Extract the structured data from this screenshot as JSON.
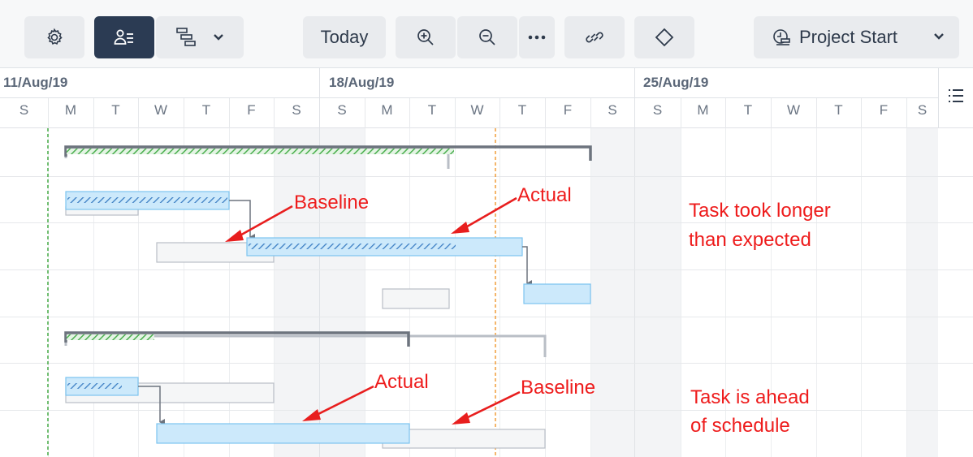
{
  "toolbar": {
    "settings_icon": "gear-icon",
    "resources_icon": "user-list-icon",
    "view_icon": "gantt-view-icon",
    "view_dropdown_icon": "chevron-down-icon",
    "today_label": "Today",
    "zoom_in_icon": "zoom-in-icon",
    "zoom_out_icon": "zoom-out-icon",
    "more_icon": "ellipsis-icon",
    "link_icon": "link-icon",
    "milestone_icon": "diamond-icon",
    "project_start_label": "Project Start",
    "project_start_icon": "project-start-icon",
    "project_start_dropdown_icon": "chevron-down-icon",
    "active_color": "#2b3b53"
  },
  "timeline": {
    "weeks": [
      "11/Aug/19",
      "18/Aug/19",
      "25/Aug/19"
    ],
    "days": [
      "S",
      "M",
      "T",
      "W",
      "T",
      "F",
      "S",
      "S",
      "M",
      "T",
      "W",
      "T",
      "F",
      "S",
      "S",
      "M",
      "T",
      "W",
      "T",
      "F",
      "S"
    ],
    "side_toggle_icon": "list-icon"
  },
  "annotations": {
    "baseline_top": "Baseline",
    "actual_top": "Actual",
    "longer_line1": "Task took longer",
    "longer_line2": "than expected",
    "actual_bottom": "Actual",
    "baseline_bottom": "Baseline",
    "ahead_line1": "Task is ahead",
    "ahead_line2": "of schedule"
  },
  "colors": {
    "task_fill": "#cce9fb",
    "task_border": "#7cc4ef",
    "progress_hatch": "#3d7fc4",
    "summary_bar": "#6d747e",
    "summary_progress": "#4caf50",
    "baseline_border": "#b9bec6",
    "today_marker": "#f0962c",
    "project_start_marker": "#3aa53a",
    "annotation": "#ee1c1c"
  }
}
